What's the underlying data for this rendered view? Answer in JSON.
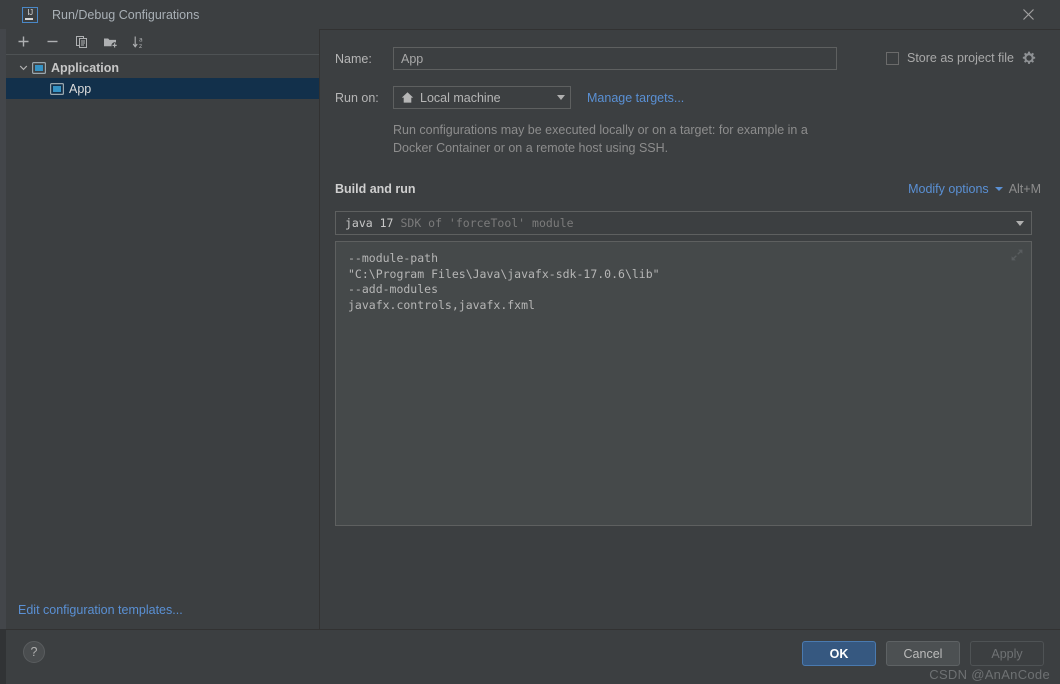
{
  "window": {
    "title": "Run/Debug Configurations",
    "app_icon": "intellij-idea-icon",
    "close_icon": "close-icon"
  },
  "sidebar": {
    "toolbar": [
      {
        "name": "add-configuration-button",
        "icon": "plus-icon",
        "label": "+"
      },
      {
        "name": "remove-configuration-button",
        "icon": "minus-icon",
        "label": "−"
      },
      {
        "name": "copy-configuration-button",
        "icon": "copy-icon",
        "label": "Copy"
      },
      {
        "name": "new-folder-button",
        "icon": "folder-add-icon",
        "label": "New Folder"
      },
      {
        "name": "sort-configurations-button",
        "icon": "sort-alphabetically-icon",
        "label": "Sort"
      }
    ],
    "tree": [
      {
        "label": "Application",
        "icon": "application-config-icon",
        "expanded": true,
        "selected": false,
        "children": [
          {
            "label": "App",
            "icon": "application-config-icon",
            "selected": true
          }
        ]
      }
    ],
    "edit_templates_link": "Edit configuration templates..."
  },
  "form": {
    "name_label": "Name:",
    "name_value": "App",
    "name_placeholder": "Name",
    "store_as_project_file_label": "Store as project file",
    "store_as_project_file_checked": false,
    "store_gear_icon": "gear-icon",
    "run_on_label": "Run on:",
    "run_on_value": "Local machine",
    "run_on_icon": "home-icon",
    "manage_targets_link": "Manage targets...",
    "help_text": "Run configurations may be executed locally or on a target: for example in a Docker Container or on a remote host using SSH."
  },
  "build_and_run": {
    "section_title": "Build and run",
    "modify_options_link": "Modify options",
    "modify_options_shortcut": "Alt+M",
    "jdk_name": "java 17",
    "jdk_description": "SDK of 'forceTool' module",
    "vm_options": "--module-path\n\"C:\\Program Files\\Java\\javafx-sdk-17.0.6\\lib\"\n--add-modules\njavafx.controls,javafx.fxml",
    "expand_icon": "expand-icon"
  },
  "footer": {
    "help_label": "?",
    "ok_label": "OK",
    "cancel_label": "Cancel",
    "apply_label": "Apply",
    "apply_enabled": false
  },
  "watermark": "CSDN @AnAnCode",
  "colors": {
    "background": "#3c3f41",
    "selection": "#12304b",
    "link": "#5a90d4",
    "primary_button": "#365880",
    "textarea_background": "#45494a",
    "border": "#5e6060"
  }
}
